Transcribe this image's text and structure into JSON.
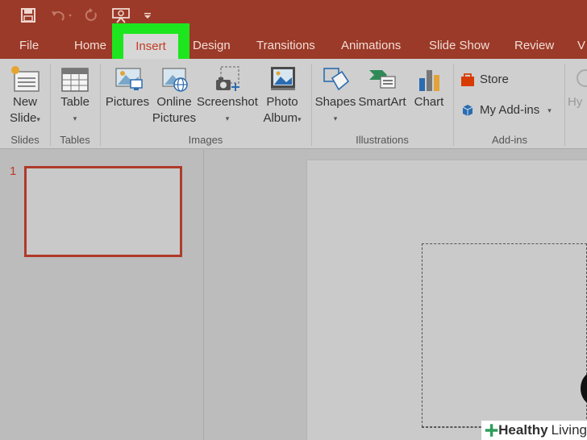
{
  "tabs": {
    "file": "File",
    "home": "Home",
    "insert": "Insert",
    "design": "Design",
    "transitions": "Transitions",
    "animations": "Animations",
    "slideshow": "Slide Show",
    "review": "Review",
    "view_partial": "V"
  },
  "ribbon": {
    "new_slide_1": "New",
    "new_slide_2": "Slide",
    "table": "Table",
    "pictures": "Pictures",
    "online_pictures_1": "Online",
    "online_pictures_2": "Pictures",
    "screenshot": "Screenshot",
    "photo_album_1": "Photo",
    "photo_album_2": "Album",
    "shapes": "Shapes",
    "smartart": "SmartArt",
    "chart": "Chart",
    "store": "Store",
    "my_addins": "My Add-ins",
    "hyperlink_partial": "Hy"
  },
  "groups": {
    "slides": "Slides",
    "tables": "Tables",
    "images": "Images",
    "illustrations": "Illustrations",
    "addins": "Add-ins"
  },
  "slides_pane": {
    "slide_number": "1"
  },
  "watermark": {
    "brand_1": "Healthy",
    "brand_2": "Living"
  },
  "colors": {
    "title_bar": "#9b3a28",
    "highlight": "#1ee61e",
    "active_tab_text": "#c43b24"
  },
  "icons": [
    "save-icon",
    "undo-icon",
    "redo-icon",
    "presenter-icon",
    "customize-qat-icon"
  ]
}
